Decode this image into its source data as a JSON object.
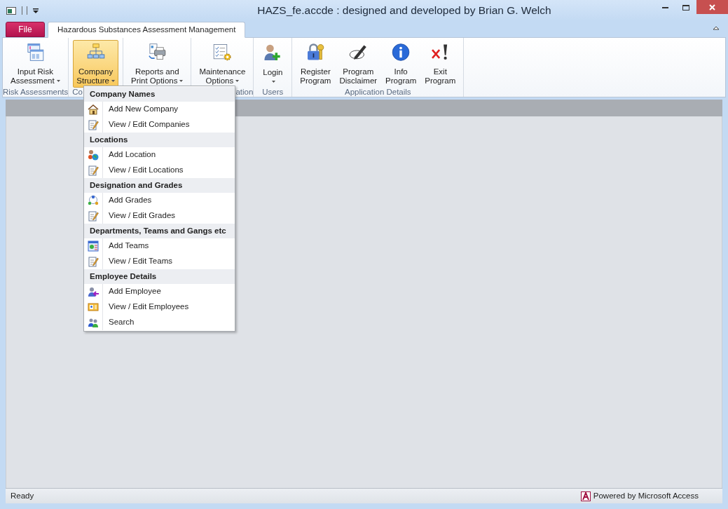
{
  "window": {
    "title": "HAZS_fe.accde : designed and developed by Brian G. Welch"
  },
  "ribbon": {
    "tabs": [
      {
        "label": "File",
        "kind": "file",
        "selected": false
      },
      {
        "label": "Hazardous Substances Assessment Management",
        "kind": "tab",
        "selected": true
      }
    ],
    "groups": [
      {
        "label": "Risk Assessments",
        "buttons": [
          {
            "lines": [
              "Input Risk",
              "Assessment"
            ],
            "kind": "forms",
            "dropdown": true,
            "pressed": false
          }
        ]
      },
      {
        "label": "Co",
        "buttons": [
          {
            "lines": [
              "Company",
              "Structure"
            ],
            "kind": "org",
            "dropdown": true,
            "pressed": true
          }
        ]
      },
      {
        "buttons": [
          {
            "lines": [
              "Reports and",
              "Print Options"
            ],
            "kind": "printer",
            "dropdown": true,
            "pressed": false
          }
        ]
      },
      {
        "label": "ation",
        "buttons": [
          {
            "lines": [
              "Maintenance",
              "Options"
            ],
            "kind": "checklist",
            "dropdown": true,
            "pressed": false
          }
        ]
      },
      {
        "label": "Users",
        "buttons": [
          {
            "lines": [
              "Login"
            ],
            "kind": "user",
            "dropdown": true,
            "pressed": false
          }
        ]
      },
      {
        "label": "Application Details",
        "buttons": [
          {
            "lines": [
              "Register",
              "Program"
            ],
            "kind": "lock",
            "dropdown": false,
            "pressed": false
          },
          {
            "lines": [
              "Program",
              "Disclaimer"
            ],
            "kind": "pen",
            "dropdown": false,
            "pressed": false
          },
          {
            "lines": [
              "Info",
              "Program"
            ],
            "kind": "info",
            "dropdown": false,
            "pressed": false
          },
          {
            "lines": [
              "Exit",
              "Program"
            ],
            "kind": "exit",
            "dropdown": false,
            "pressed": false
          }
        ]
      }
    ]
  },
  "menu": {
    "sections": [
      {
        "heading": "Company Names",
        "items": [
          {
            "label": "Add New Company",
            "kind": "house"
          },
          {
            "label": "View / Edit Companies",
            "kind": "edit"
          }
        ]
      },
      {
        "heading": "Locations",
        "items": [
          {
            "label": "Add Location",
            "kind": "location"
          },
          {
            "label": "View / Edit Locations",
            "kind": "edit"
          }
        ]
      },
      {
        "heading": "Designation and Grades",
        "items": [
          {
            "label": "Add Grades",
            "kind": "grades"
          },
          {
            "label": "View / Edit Grades",
            "kind": "edit"
          }
        ]
      },
      {
        "heading": "Departments, Teams and Gangs etc",
        "items": [
          {
            "label": "Add Teams",
            "kind": "teams"
          },
          {
            "label": "View / Edit Teams",
            "kind": "edit"
          }
        ]
      },
      {
        "heading": "Employee Details",
        "items": [
          {
            "label": "Add Employee",
            "kind": "employee"
          },
          {
            "label": "View / Edit Employees",
            "kind": "card"
          },
          {
            "label": "Search",
            "kind": "people"
          }
        ]
      }
    ]
  },
  "status_bar": {
    "status": "Ready",
    "brand": "Powered by Microsoft Access"
  }
}
